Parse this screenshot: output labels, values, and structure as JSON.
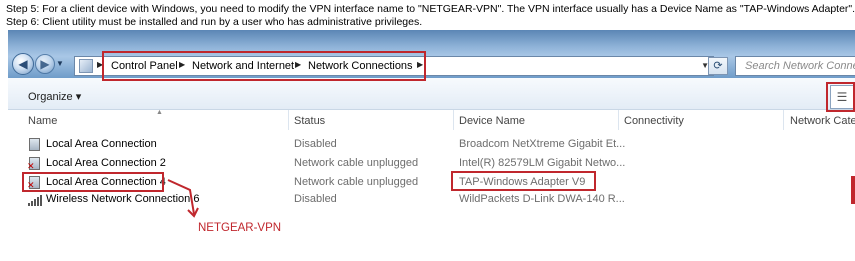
{
  "instructions": {
    "step5": "Step 5: For a client device with Windows, you need to modify the VPN interface name to \"NETGEAR-VPN\". The VPN interface usually has a Device Name as \"TAP-Windows Adapter\".",
    "step6": "Step 6: Client utility must be installed and run by a user who has administrative privileges."
  },
  "explorer": {
    "breadcrumbs": [
      "Control Panel",
      "Network and Internet",
      "Network Connections"
    ],
    "search_placeholder": "Search Network Connections",
    "organize_label": "Organize ▾",
    "icons": [
      "back-arrow-icon",
      "forward-arrow-icon",
      "control-panel-icon",
      "refresh-icon",
      "view-details-icon",
      "network-adapter-icon",
      "wireless-signal-icon"
    ],
    "columns": [
      "Name",
      "Status",
      "Device Name",
      "Connectivity",
      "Network Category"
    ],
    "rows": [
      {
        "name": "Local Area Connection",
        "status": "Disabled",
        "device": "Broadcom NetXtreme Gigabit Et...",
        "icon": "network-adapter-icon"
      },
      {
        "name": "Local Area Connection 2",
        "status": "Network cable unplugged",
        "device": "Intel(R) 82579LM Gigabit Netwo...",
        "icon": "network-adapter-icon"
      },
      {
        "name": "Local Area Connection 4",
        "status": "Network cable unplugged",
        "device": "TAP-Windows Adapter V9",
        "icon": "network-adapter-icon"
      },
      {
        "name": "Wireless Network Connection 6",
        "status": "Disabled",
        "device": "WildPackets D-Link DWA-140 R...",
        "icon": "wireless-signal-icon"
      }
    ]
  },
  "annotation": {
    "label": "NETGEAR-VPN",
    "color": "#c0272d"
  }
}
